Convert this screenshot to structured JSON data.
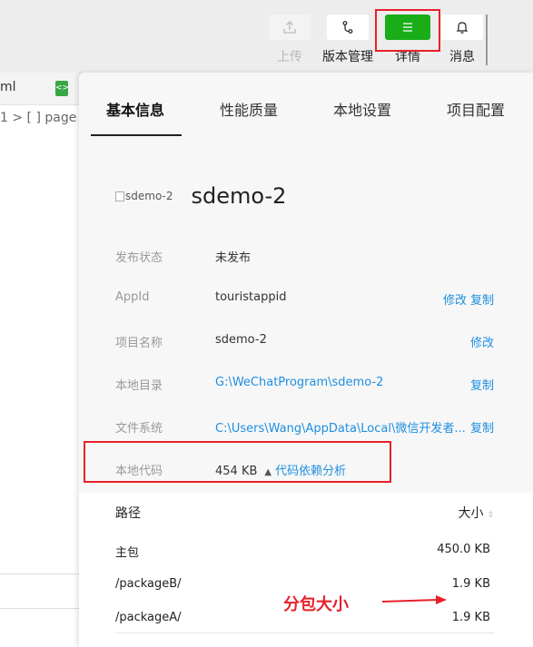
{
  "toolbar": {
    "items": [
      {
        "label": "上传",
        "icon": "upload-icon"
      },
      {
        "label": "版本管理",
        "icon": "branch-icon"
      },
      {
        "label": "详情",
        "icon": "menu-icon"
      },
      {
        "label": "消息",
        "icon": "bell-icon"
      }
    ],
    "active_color": "#1aad19",
    "annotation_color": "#e8202a"
  },
  "editor": {
    "tab_fragment": "ml",
    "breadcrumb": "1 > [ ] page"
  },
  "detail": {
    "tabs": [
      "基本信息",
      "性能质量",
      "本地设置",
      "项目配置"
    ],
    "project": {
      "image_alt": "sdemo-2",
      "name": "sdemo-2"
    },
    "rows": {
      "status": {
        "label": "发布状态",
        "value": "未发布"
      },
      "appid": {
        "label": "AppId",
        "value": "touristappid",
        "action1": "修改",
        "action2": "复制"
      },
      "name": {
        "label": "项目名称",
        "value": "sdemo-2",
        "action1": "修改"
      },
      "dir": {
        "label": "本地目录",
        "value": "G:\\WeChatProgram\\sdemo-2",
        "action1": "复制"
      },
      "fs": {
        "label": "文件系统",
        "value": "C:\\Users\\Wang\\AppData\\Local\\微信开发者...",
        "action1": "复制"
      },
      "code": {
        "label": "本地代码",
        "value": "454 KB",
        "link": "代码依赖分析"
      }
    },
    "table": {
      "col_path": "路径",
      "col_size": "大小",
      "rows": [
        {
          "path": "主包",
          "size": "450.0 KB"
        },
        {
          "path": "/packageB/",
          "size": "1.9 KB"
        },
        {
          "path": "/packageA/",
          "size": "1.9 KB"
        }
      ]
    },
    "link_color": "#1e8fe1"
  },
  "annotation": {
    "text": "分包大小"
  }
}
